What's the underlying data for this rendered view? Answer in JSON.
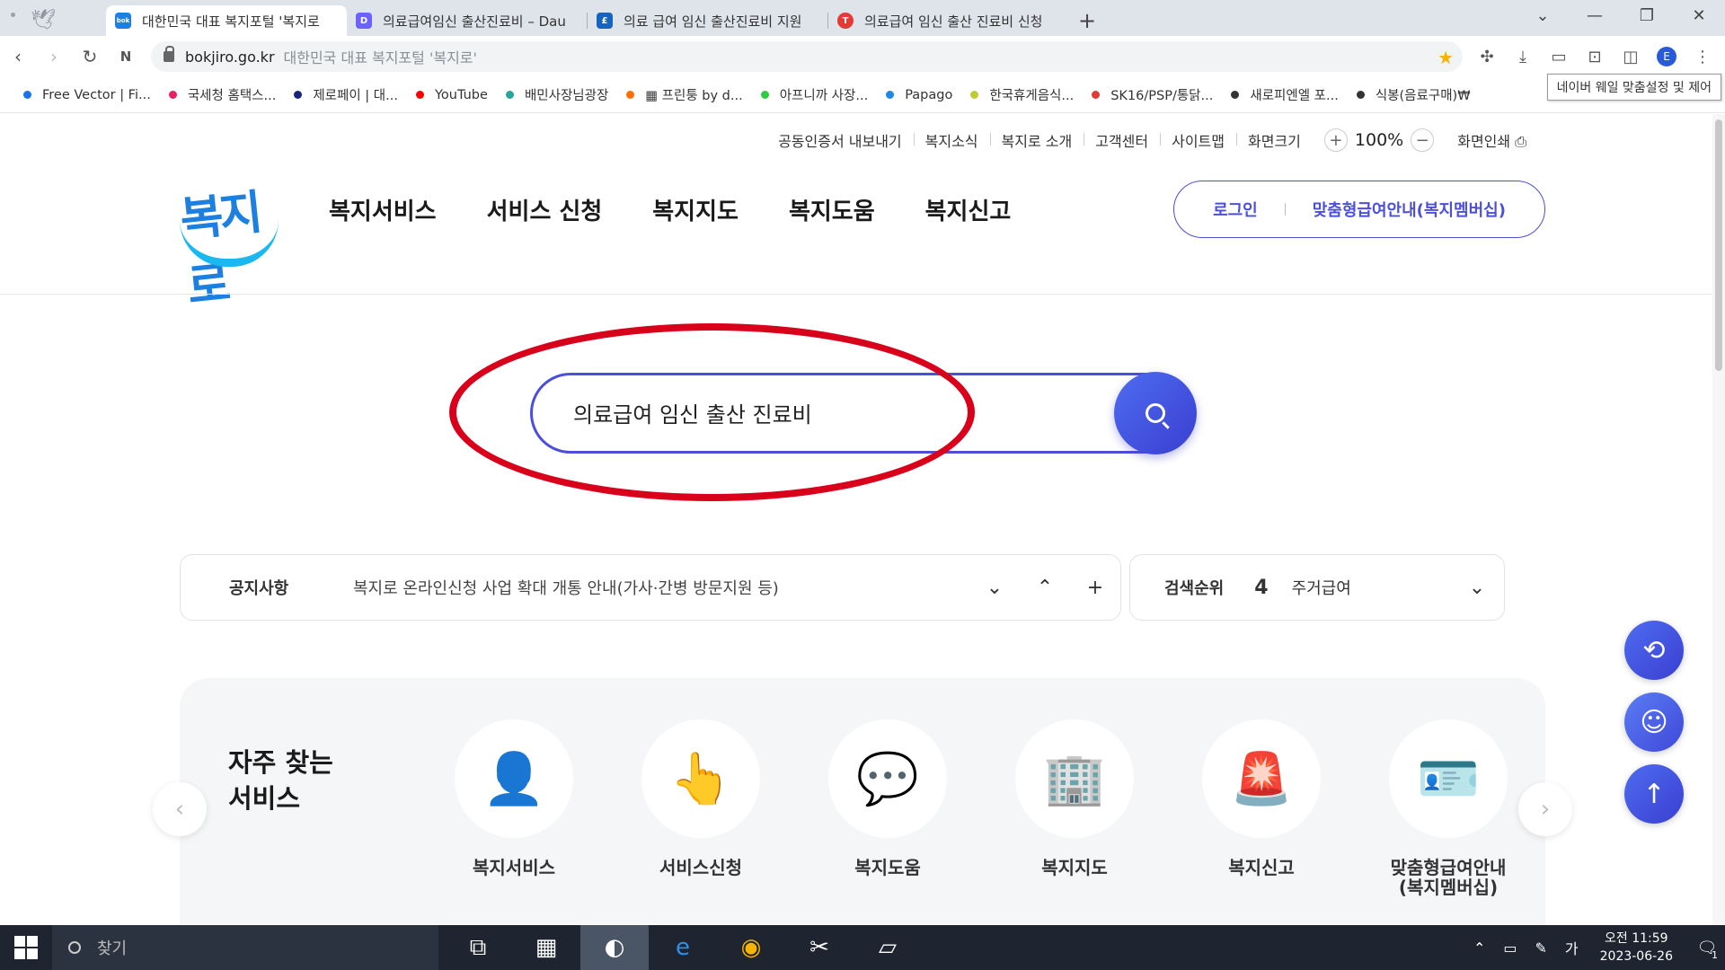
{
  "browser": {
    "tabs": [
      {
        "title": "대한민국 대표 복지포털 '복지로",
        "favicon_color": "#1d7fe0",
        "favicon_text": "bok",
        "active": true
      },
      {
        "title": "의료급여임신 출산진료비 – Dau",
        "favicon_color": "#6c63ff",
        "favicon_text": "D",
        "active": false
      },
      {
        "title": "의료 급여 임신 출산진료비 지원",
        "favicon_color": "#1565c0",
        "favicon_text": "£",
        "active": false
      },
      {
        "title": "의료급여 임신 출산 진료비 신청",
        "favicon_color": "#e53935",
        "favicon_text": "T",
        "active": false
      }
    ],
    "address": {
      "domain": "bokjiro.go.kr",
      "page_title": "대한민국 대표 복지포털 '복지로'"
    },
    "bookmarks": [
      {
        "label": "Free Vector | Fi...",
        "color": "#1a73e8"
      },
      {
        "label": "국세청 홈택스...",
        "color": "#e91e63"
      },
      {
        "label": "제로페이 | 대...",
        "color": "#1a237e"
      },
      {
        "label": "YouTube",
        "color": "#ff0000"
      },
      {
        "label": "배민사장님광장",
        "color": "#26a69a"
      },
      {
        "label": "▦ 프린퉁 by d...",
        "color": "#ff6f00"
      },
      {
        "label": "아프니까 사장...",
        "color": "#2ecc40"
      },
      {
        "label": "Papago",
        "color": "#1e88e5"
      },
      {
        "label": "한국휴게음식...",
        "color": "#c0ca33"
      },
      {
        "label": "SK16/PSP/통닭...",
        "color": "#e53935"
      },
      {
        "label": "새로피엔엘 포...",
        "color": "#333333"
      },
      {
        "label": "식봉(음료구매)₩",
        "color": "#333333"
      }
    ],
    "tooltip": "네이버 웨일 맞춤설정 및 제어"
  },
  "header": {
    "util_links": [
      "공동인증서 내보내기",
      "복지소식",
      "복지로 소개",
      "고객센터",
      "사이트맵",
      "화면크기"
    ],
    "zoom": "100%",
    "print_label": "화면인쇄",
    "logo_text": "복지로",
    "gnb": [
      "복지서비스",
      "서비스 신청",
      "복지지도",
      "복지도움",
      "복지신고"
    ],
    "login_label": "로그인",
    "member_label": "맞춤형급여안내(복지멤버십)"
  },
  "search": {
    "value": "의료급여 임신 출산 진료비"
  },
  "notice": {
    "label": "공지사항",
    "text": "복지로 온라인신청 사업 확대 개통 안내(가사·간병 방문지원 등)"
  },
  "rank": {
    "label": "검색순위",
    "number": "4",
    "text": "주거급여"
  },
  "frequent": {
    "title_line1": "자주 찾는",
    "title_line2": "서비스",
    "items": [
      {
        "label": "복지서비스",
        "icon": "people-icon"
      },
      {
        "label": "서비스신청",
        "icon": "hand-click-icon"
      },
      {
        "label": "복지도움",
        "icon": "chat-card-icon"
      },
      {
        "label": "복지지도",
        "icon": "building-icon"
      },
      {
        "label": "복지신고",
        "icon": "siren-icon"
      },
      {
        "label": "맞춤형급여안내\n(복지멤버십)",
        "icon": "id-card-icon"
      }
    ]
  },
  "taskbar": {
    "search_placeholder": "찾기",
    "ime": "가",
    "time": "오전 11:59",
    "date": "2023-06-26",
    "notifications": "1"
  }
}
